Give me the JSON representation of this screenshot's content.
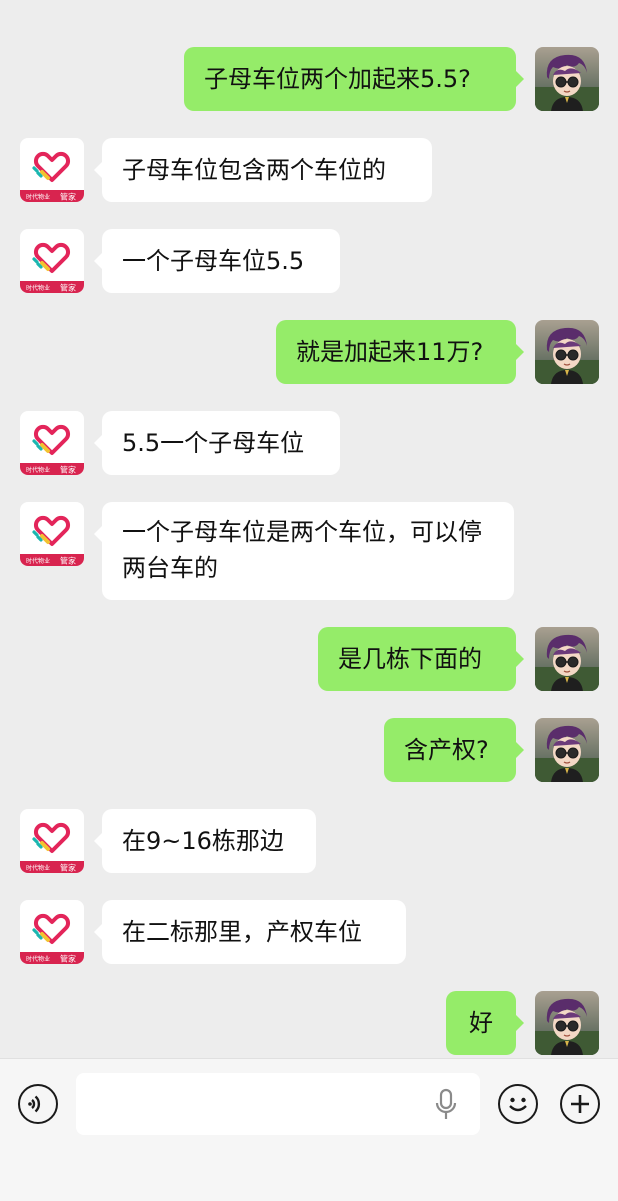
{
  "messages": [
    {
      "side": "out",
      "text": "子母车位两个加起来5.5?"
    },
    {
      "side": "in",
      "text": "子母车位包含两个车位的"
    },
    {
      "side": "in",
      "text": "一个子母车位5.5"
    },
    {
      "side": "out",
      "text": "就是加起来11万?"
    },
    {
      "side": "in",
      "text": "5.5一个子母车位"
    },
    {
      "side": "in",
      "text": "一个子母车位是两个车位，可以停两台车的"
    },
    {
      "side": "out",
      "text": "是几栋下面的"
    },
    {
      "side": "out",
      "text": "含产权?"
    },
    {
      "side": "in",
      "text": "在9~16栋那边"
    },
    {
      "side": "in",
      "text": "在二标那里，产权车位"
    },
    {
      "side": "out",
      "text": "好"
    }
  ],
  "contact_avatar": {
    "label": "管家",
    "small_text": "时代物业",
    "icon": "heart-logo-icon",
    "colors": [
      "#e3255a",
      "#f2c230",
      "#1bb6b0"
    ]
  },
  "self_avatar": {
    "icon": "anime-boy-avatar-icon"
  },
  "input_bar": {
    "voice_icon": "voice-mode-icon",
    "mic_icon": "microphone-icon",
    "emoji_icon": "emoji-icon",
    "add_icon": "add-icon",
    "value": "",
    "placeholder": ""
  }
}
